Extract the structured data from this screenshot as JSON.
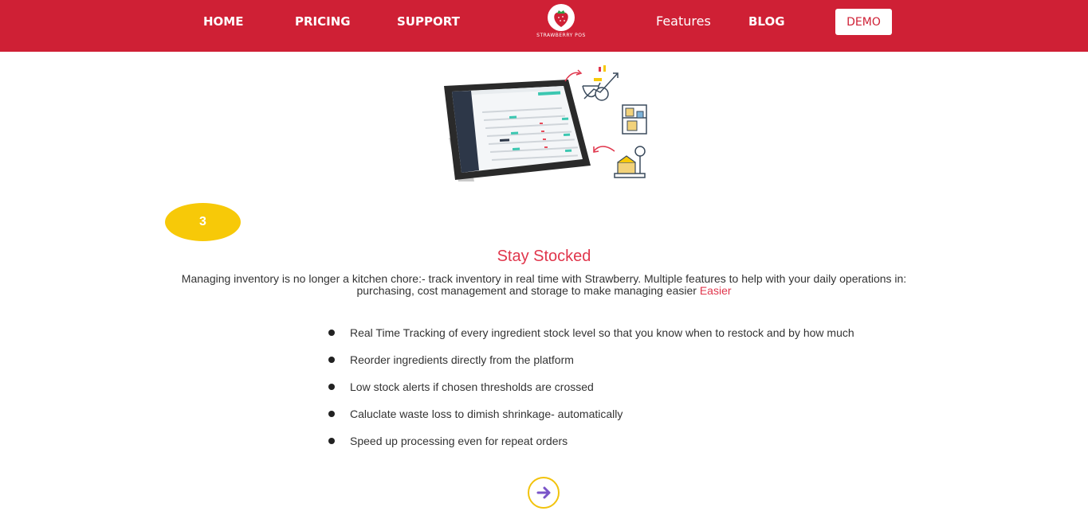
{
  "nav": {
    "home": "HOME",
    "pricing": "PRICING",
    "support": "SUPPORT",
    "features": "Features",
    "blog": "BLOG",
    "demo": "DEMO"
  },
  "logo": {
    "text": "STRAWBERRY POS"
  },
  "section": {
    "step_number": "3",
    "title": "Stay Stocked",
    "description": "Managing inventory is no longer a kitchen chore:- track inventory in real time with Strawberry. Multiple features to help with your daily operations in: purchasing, cost management and storage to make managing easier",
    "description_link": "Easier",
    "features": [
      "Real Time Tracking of every ingredient stock level so that you know when to restock and by how much",
      "Reorder ingredients directly from the platform",
      "Low stock alerts if chosen thresholds are crossed",
      "Caluclate waste loss to dimish shrinkage- automatically",
      "Speed up processing even for repeat orders"
    ]
  },
  "colors": {
    "brand_red": "#cf2035",
    "title_red": "#e0364c",
    "badge_yellow": "#f7c908",
    "arrow_purple": "#7a55c8"
  },
  "icons": {
    "next": "arrow-right-icon",
    "logo": "strawberry-icon"
  }
}
